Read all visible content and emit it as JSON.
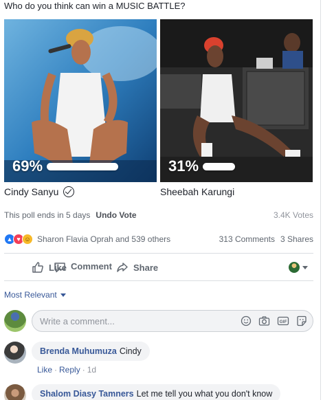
{
  "poll": {
    "question": "Who do you think can win a MUSIC BATTLE?",
    "options": [
      {
        "name": "Cindy Sanyu",
        "percent_label": "69%",
        "percent": 69,
        "selected": true
      },
      {
        "name": "Sheebah Karungi",
        "percent_label": "31%",
        "percent": 31,
        "selected": false
      }
    ],
    "ends_text": "This poll ends in 5 days",
    "undo_label": "Undo Vote",
    "votes": "3.4K Votes"
  },
  "reactions": {
    "icons": [
      "like-icon",
      "love-icon",
      "haha-icon"
    ],
    "names": "Sharon Flavia Oprah and 539 others",
    "comments": "313 Comments",
    "shares": "3 Shares"
  },
  "actions": {
    "like": "Like",
    "comment": "Comment",
    "share": "Share"
  },
  "sort": {
    "label": "Most Relevant"
  },
  "composer": {
    "placeholder": "Write a comment...",
    "tools": [
      "emoji-icon",
      "camera-icon",
      "gif-icon",
      "sticker-icon"
    ]
  },
  "comments": [
    {
      "author": "Brenda Muhumuza",
      "text": "Cindy",
      "like": "Like",
      "reply": "Reply",
      "time": "1d"
    },
    {
      "author": "Shalom Diasy Tamners",
      "text": "Let me tell you what you don't know"
    }
  ],
  "colors": {
    "link": "#385898",
    "meta": "#606770",
    "bubble": "#f2f3f5"
  }
}
